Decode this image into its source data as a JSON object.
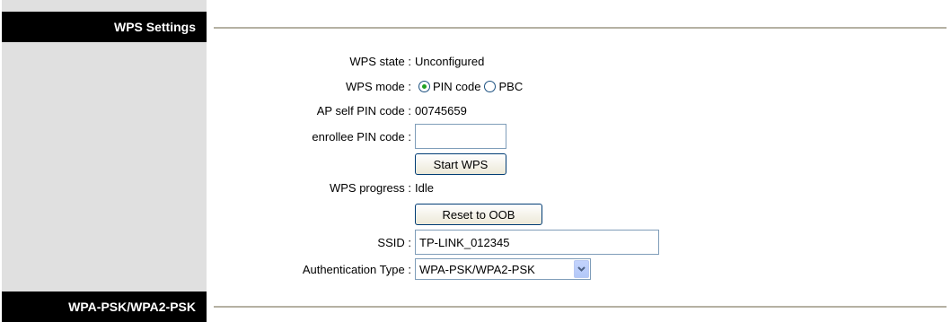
{
  "sections": {
    "wps_settings": "WPS Settings",
    "wpa_psk": "WPA-PSK/WPA2-PSK"
  },
  "form": {
    "wps_state": {
      "label": "WPS state :",
      "value": "Unconfigured"
    },
    "wps_mode": {
      "label": "WPS mode :",
      "options": [
        {
          "label": "PIN code",
          "checked": true
        },
        {
          "label": "PBC",
          "checked": false
        }
      ]
    },
    "ap_pin": {
      "label": "AP self PIN code :",
      "value": "00745659"
    },
    "enrollee_pin": {
      "label": "enrollee PIN code :",
      "value": ""
    },
    "start_wps_button": "Start WPS",
    "wps_progress": {
      "label": "WPS progress :",
      "value": "Idle"
    },
    "reset_button": "Reset to OOB",
    "ssid": {
      "label": "SSID :",
      "value": "TP-LINK_012345"
    },
    "auth_type": {
      "label": "Authentication Type :",
      "selected": "WPA-PSK/WPA2-PSK"
    }
  },
  "colors": {
    "sidebar": "#e0e0e0",
    "header": "#000000",
    "rule": "#b5b1a3",
    "radio_dot": "#21a121"
  },
  "icons": {
    "dropdown": "chevron-down-icon"
  }
}
